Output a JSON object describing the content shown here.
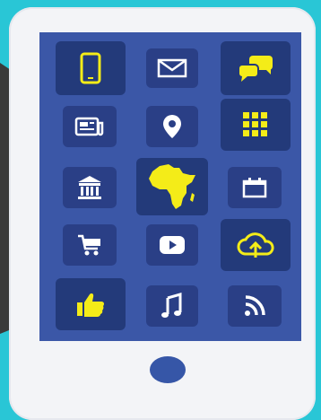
{
  "colors": {
    "background": "#29c6d6",
    "phone_body": "#f3f4f7",
    "screen": "#3b57a7",
    "tile_dark": "#2a3f86",
    "icon_yellow": "#f4ec18",
    "icon_white": "#ffffff",
    "home_button": "#3656a7"
  },
  "app_grid": {
    "rows": [
      [
        "smartphone-icon",
        "mail-icon",
        "chat-bubbles-icon"
      ],
      [
        "newspaper-icon",
        "location-pin-icon",
        "keypad-grid-icon"
      ],
      [
        "bank-building-icon",
        "africa-map-icon",
        "calendar-icon"
      ],
      [
        "shopping-cart-icon",
        "play-video-icon",
        "cloud-upload-icon"
      ],
      [
        "thumbs-up-icon",
        "music-note-icon",
        "rss-feed-icon"
      ]
    ]
  }
}
